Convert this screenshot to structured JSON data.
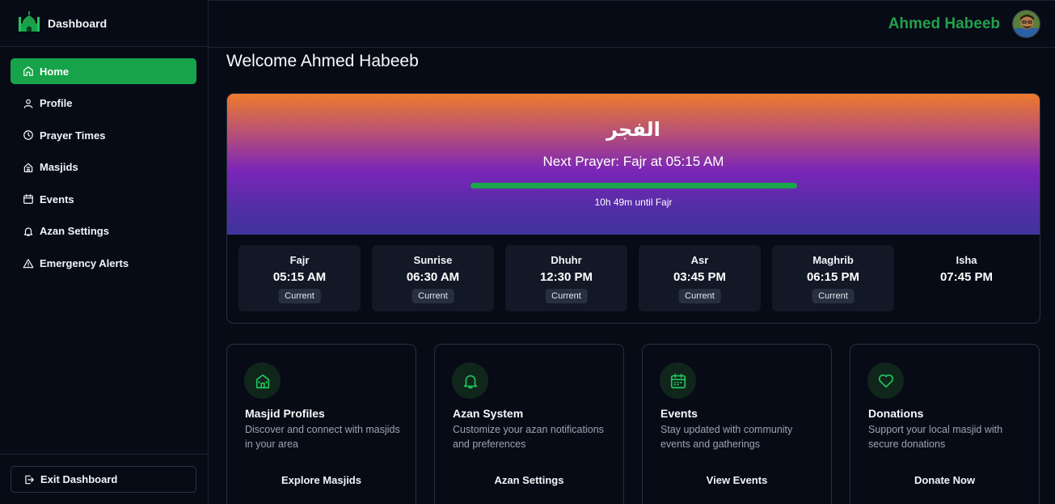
{
  "sidebar": {
    "brand_title": "Dashboard",
    "items": [
      {
        "label": "Home",
        "icon": "home-icon",
        "active": true
      },
      {
        "label": "Profile",
        "icon": "user-icon"
      },
      {
        "label": "Prayer Times",
        "icon": "clock-icon"
      },
      {
        "label": "Masjids",
        "icon": "masjid-icon"
      },
      {
        "label": "Events",
        "icon": "calendar-icon"
      },
      {
        "label": "Azan Settings",
        "icon": "bell-icon"
      },
      {
        "label": "Emergency Alerts",
        "icon": "warning-icon"
      }
    ],
    "exit_label": "Exit Dashboard"
  },
  "header": {
    "user_name": "Ahmed Habeeb"
  },
  "main": {
    "welcome": "Welcome Ahmed Habeeb",
    "hero": {
      "arabic_name": "الفجر",
      "next_prayer": "Next Prayer: Fajr at 05:15 AM",
      "progress_fraction": 1.0,
      "countdown": "10h 49m until Fajr"
    },
    "prayer_times": [
      {
        "name": "Fajr",
        "time": "05:15 AM",
        "badge": "Current"
      },
      {
        "name": "Sunrise",
        "time": "06:30 AM",
        "badge": "Current"
      },
      {
        "name": "Dhuhr",
        "time": "12:30 PM",
        "badge": "Current"
      },
      {
        "name": "Asr",
        "time": "03:45 PM",
        "badge": "Current"
      },
      {
        "name": "Maghrib",
        "time": "06:15 PM",
        "badge": "Current"
      },
      {
        "name": "Isha",
        "time": "07:45 PM",
        "badge": ""
      }
    ],
    "features": [
      {
        "title": "Masjid Profiles",
        "description": "Discover and connect with masjids in your area",
        "link": "Explore Masjids",
        "icon": "masjid-icon"
      },
      {
        "title": "Azan System",
        "description": "Customize your azan notifications and preferences",
        "link": "Azan Settings",
        "icon": "bell-icon"
      },
      {
        "title": "Events",
        "description": "Stay updated with community events and gatherings",
        "link": "View Events",
        "icon": "calendar-icon"
      },
      {
        "title": "Donations",
        "description": "Support your local masjid with secure donations",
        "link": "Donate Now",
        "icon": "heart-icon"
      }
    ]
  },
  "colors": {
    "accent": "#16a34a",
    "username": "#22a04b",
    "background": "#070b16"
  }
}
